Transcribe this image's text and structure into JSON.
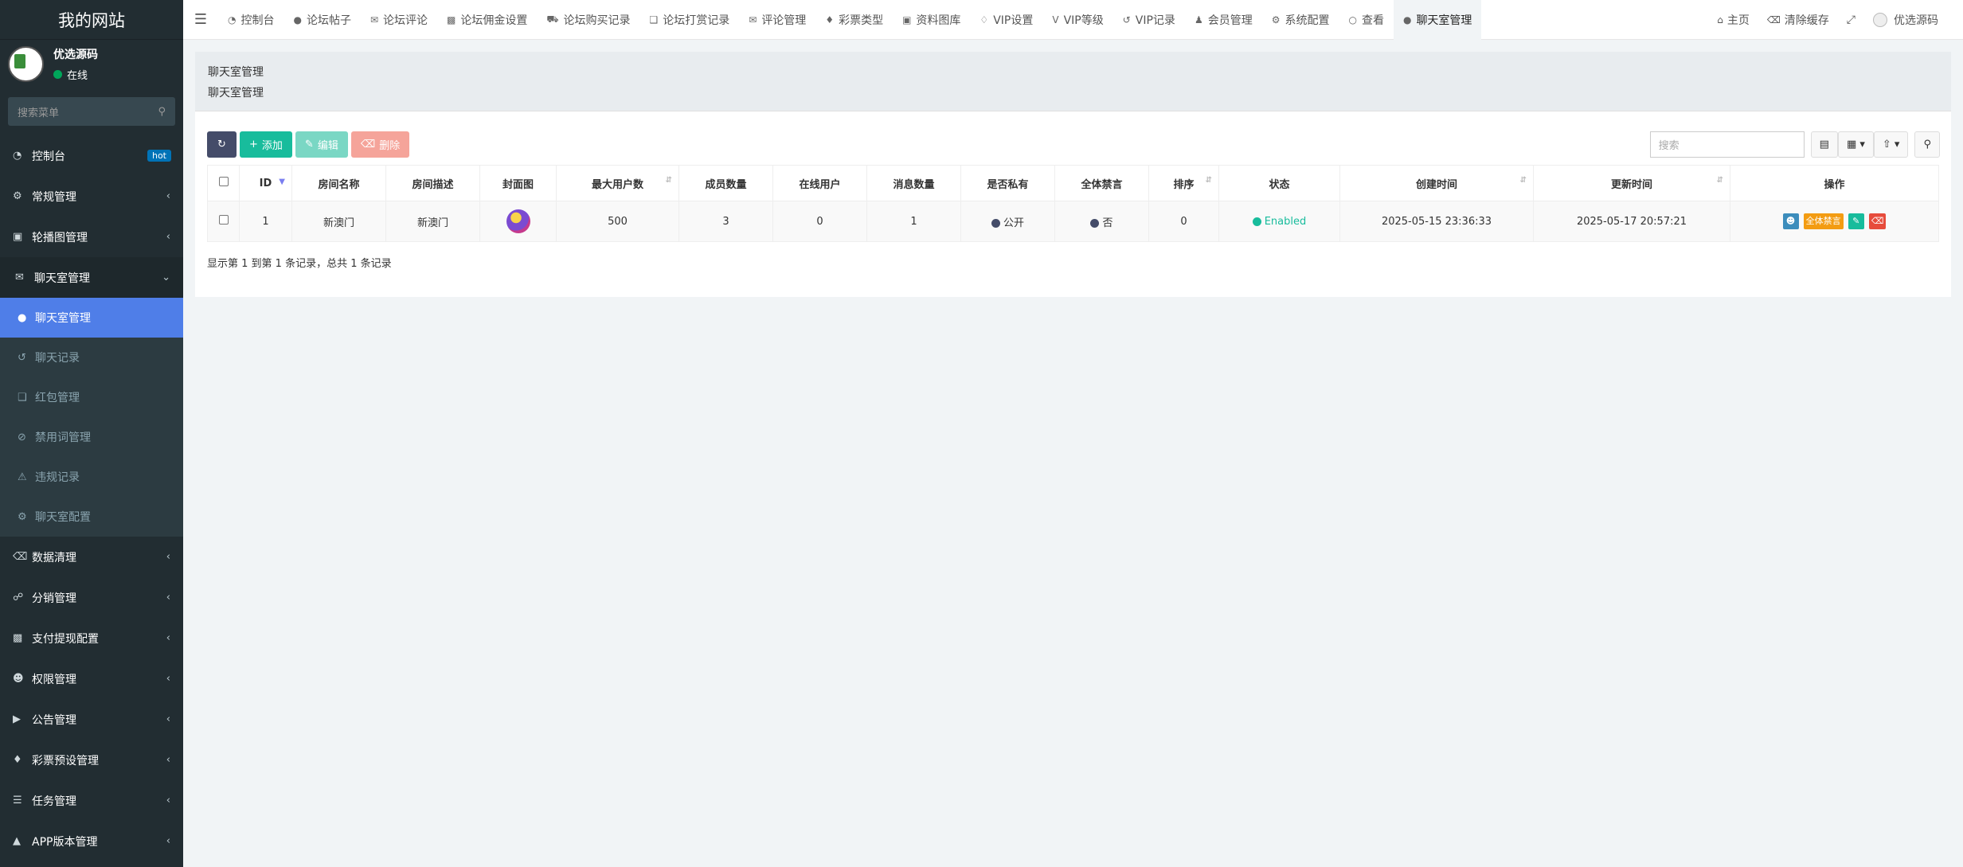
{
  "sidebar": {
    "brand": "我的网站",
    "user": {
      "name": "优选源码",
      "status": "在线"
    },
    "search_placeholder": "搜索菜单",
    "top_items": [
      {
        "label": "控制台",
        "icon": "dashboard-icon",
        "badge": "hot"
      },
      {
        "label": "常规管理",
        "icon": "cogs-icon"
      },
      {
        "label": "轮播图管理",
        "icon": "image-icon"
      },
      {
        "label": "聊天室管理",
        "icon": "comments-icon"
      }
    ],
    "chat_submenu": [
      {
        "label": "聊天室管理",
        "icon": "comment-icon",
        "active": true
      },
      {
        "label": "聊天记录",
        "icon": "history-icon"
      },
      {
        "label": "红包管理",
        "icon": "gift-icon"
      },
      {
        "label": "禁用词管理",
        "icon": "ban-icon"
      },
      {
        "label": "违规记录",
        "icon": "warning-icon"
      },
      {
        "label": "聊天室配置",
        "icon": "cogs-icon"
      }
    ],
    "bottom_items": [
      {
        "label": "数据清理",
        "icon": "trash-icon"
      },
      {
        "label": "分销管理",
        "icon": "share-icon"
      },
      {
        "label": "支付提现配置",
        "icon": "money-icon"
      },
      {
        "label": "权限管理",
        "icon": "group-icon"
      },
      {
        "label": "公告管理",
        "icon": "bullhorn-icon"
      },
      {
        "label": "彩票预设管理",
        "icon": "ticket-icon"
      },
      {
        "label": "任务管理",
        "icon": "tasks-icon"
      },
      {
        "label": "APP版本管理",
        "icon": "android-icon"
      }
    ]
  },
  "topbar": {
    "tabs": [
      {
        "label": "控制台",
        "icon": "dashboard-icon"
      },
      {
        "label": "论坛帖子",
        "icon": "comment-icon"
      },
      {
        "label": "论坛评论",
        "icon": "comments-icon"
      },
      {
        "label": "论坛佣金设置",
        "icon": "money-icon"
      },
      {
        "label": "论坛购买记录",
        "icon": "cart-icon"
      },
      {
        "label": "论坛打赏记录",
        "icon": "gift-icon"
      },
      {
        "label": "评论管理",
        "icon": "comments-icon"
      },
      {
        "label": "彩票类型",
        "icon": "ticket-icon"
      },
      {
        "label": "资料图库",
        "icon": "image-icon"
      },
      {
        "label": "VIP设置",
        "icon": "diamond-icon"
      },
      {
        "label": "VIP等级",
        "icon": "vimeo-icon"
      },
      {
        "label": "VIP记录",
        "icon": "history-icon"
      },
      {
        "label": "会员管理",
        "icon": "user-icon"
      },
      {
        "label": "系统配置",
        "icon": "gear-icon"
      },
      {
        "label": "查看",
        "icon": "circle-icon"
      },
      {
        "label": "聊天室管理",
        "icon": "comment-icon",
        "active": true
      }
    ],
    "right": {
      "home": "主页",
      "clear_cache": "清除缓存",
      "username": "优选源码"
    }
  },
  "panel": {
    "title": "聊天室管理",
    "subtitle": "聊天室管理",
    "toolbar": {
      "add": "添加",
      "edit": "编辑",
      "delete": "删除"
    },
    "search_placeholder": "搜索"
  },
  "table": {
    "columns": [
      "ID",
      "房间名称",
      "房间描述",
      "封面图",
      "最大用户数",
      "成员数量",
      "在线用户",
      "消息数量",
      "是否私有",
      "全体禁言",
      "排序",
      "状态",
      "创建时间",
      "更新时间",
      "操作"
    ],
    "rows": [
      {
        "id": "1",
        "name": "新澳门",
        "description": "新澳门",
        "max_users": "500",
        "members": "3",
        "online": "0",
        "messages": "1",
        "private": "公开",
        "mute_all": "否",
        "sort": "0",
        "status": "Enabled",
        "created": "2025-05-15 23:36:33",
        "updated": "2025-05-17 20:57:21",
        "op_mute_label": "全体禁言"
      }
    ]
  },
  "pager": {
    "info": "显示第 1 到第 1 条记录，总共 1 条记录"
  },
  "colors": {
    "sidebar_bg": "#222d32",
    "active_blue": "#4f7ee8",
    "success": "#18bc9c",
    "danger": "#e74c3c"
  }
}
